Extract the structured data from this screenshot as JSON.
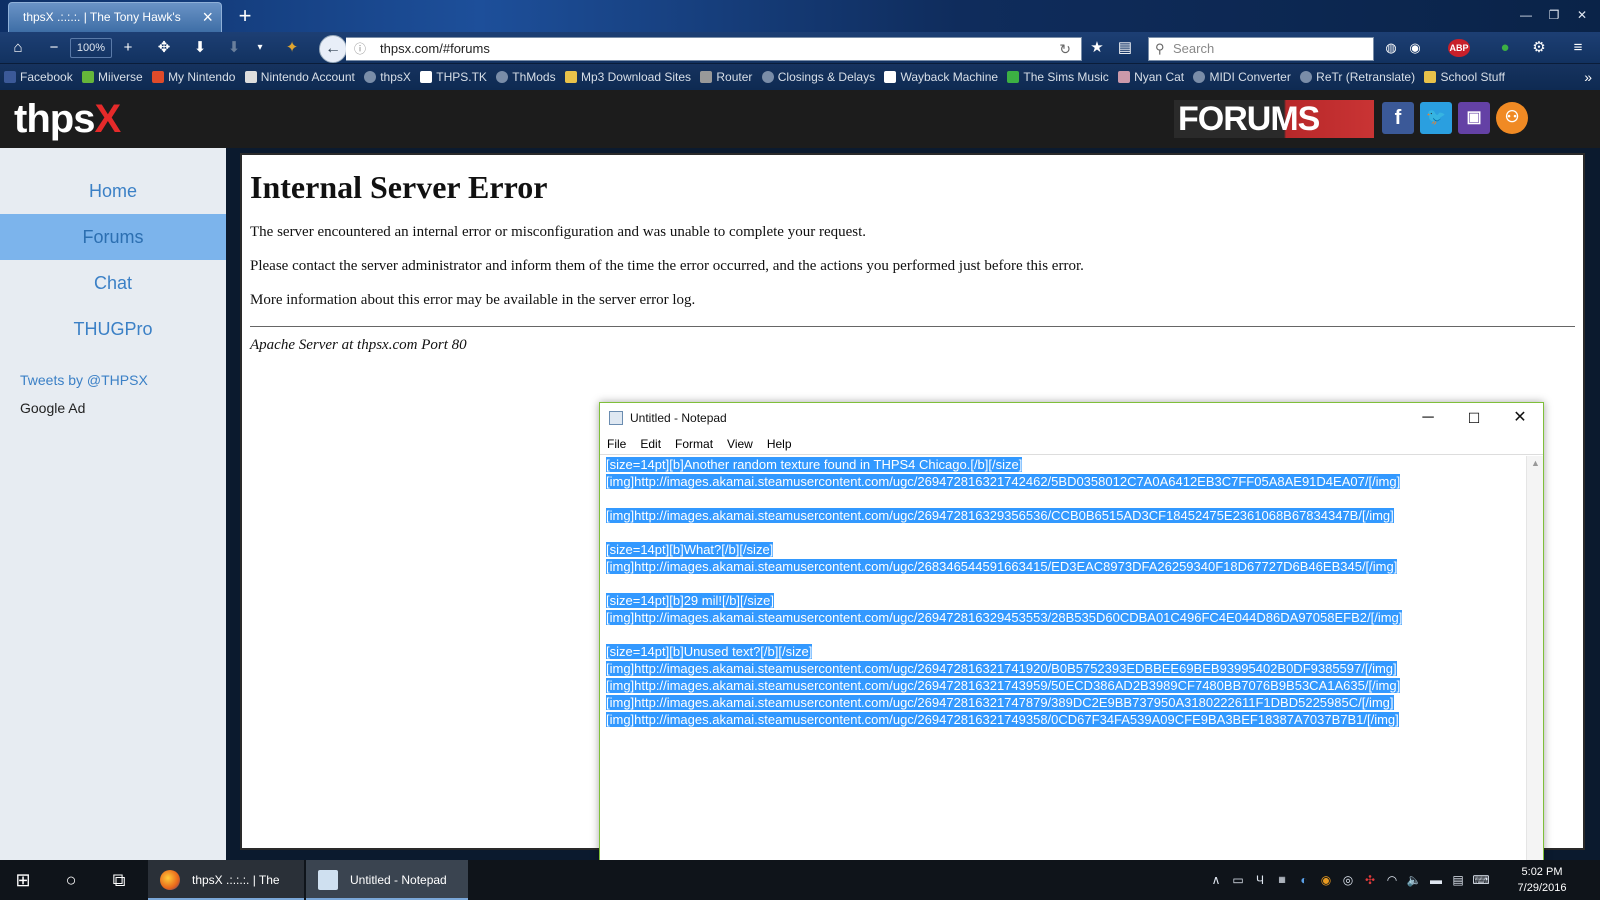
{
  "browser": {
    "tab_title": "thpsX .:.:.:. | The Tony Hawk's ...",
    "zoom": "100%",
    "url": "thpsx.com/#forums",
    "search_placeholder": "Search",
    "bookmarks": [
      "Facebook",
      "Miiverse",
      "My Nintendo",
      "Nintendo Account",
      "thpsX",
      "THPS.TK",
      "ThMods",
      "Mp3 Download Sites",
      "Router",
      "Closings & Delays",
      "Wayback Machine",
      "The Sims Music",
      "Nyan Cat",
      "MIDI Converter",
      "ReTr (Retranslate)",
      "School Stuff"
    ]
  },
  "site": {
    "logo_main": "thps",
    "logo_accent": "X",
    "banner": "FORUMS",
    "nav": [
      "Home",
      "Forums",
      "Chat",
      "THUGPro"
    ],
    "active_nav": "Forums",
    "tweets": "Tweets by @THPSX",
    "google_ad": "Google Ad",
    "social": {
      "facebook": "f",
      "twitter": "t",
      "twitch": "tw",
      "group": "g"
    }
  },
  "error": {
    "title": "Internal Server Error",
    "p1": "The server encountered an internal error or misconfiguration and was unable to complete your request.",
    "p2": "Please contact the server administrator and inform them of the time the error occurred, and the actions you performed just before this error.",
    "p3": "More information about this error may be available in the server error log.",
    "signature": "Apache Server at thpsx.com Port 80"
  },
  "notepad": {
    "title": "Untitled - Notepad",
    "menu": [
      "File",
      "Edit",
      "Format",
      "View",
      "Help"
    ],
    "lines": [
      "[size=14pt][b]Another random texture found in THPS4 Chicago.[/b][/size]",
      "[img]http://images.akamai.steamusercontent.com/ugc/269472816321742462/5BD0358012C7A0A6412EB3C7FF05A8AE91D4EA07/[/img]",
      "",
      "[img]http://images.akamai.steamusercontent.com/ugc/269472816329356536/CCB0B6515AD3CF18452475E2361068B67834347B/[/img]",
      "",
      "[size=14pt][b]What?[/b][/size]",
      "[img]http://images.akamai.steamusercontent.com/ugc/268346544591663415/ED3EAC8973DFA26259340F18D67727D6B46EB345/[/img]",
      "",
      "[size=14pt][b]29 mil![/b][/size]",
      "[img]http://images.akamai.steamusercontent.com/ugc/269472816329453553/28B535D60CDBA01C496FC4E044D86DA97058EFB2/[/img]",
      "",
      "[size=14pt][b]Unused text?[/b][/size]",
      "[img]http://images.akamai.steamusercontent.com/ugc/269472816321741920/B0B5752393EDBBEE69BEB93995402B0DF9385597/[/img]",
      "[img]http://images.akamai.steamusercontent.com/ugc/269472816321743959/50ECD386AD2B3989CF7480BB7076B9B53CA1A635/[/img]",
      "[img]http://images.akamai.steamusercontent.com/ugc/269472816321747879/389DC2E9BB737950A3180222611F1DBD5225985C/[/img]",
      "[img]http://images.akamai.steamusercontent.com/ugc/269472816321749358/0CD67F34FA539A09CFE9BA3BEF18387A7037B7B1/[/img]"
    ]
  },
  "taskbar": {
    "apps": [
      {
        "label": "thpsX .:.:.:. | The To..."
      },
      {
        "label": "Untitled - Notepad"
      }
    ],
    "time": "5:02 PM",
    "date": "7/29/2016"
  }
}
